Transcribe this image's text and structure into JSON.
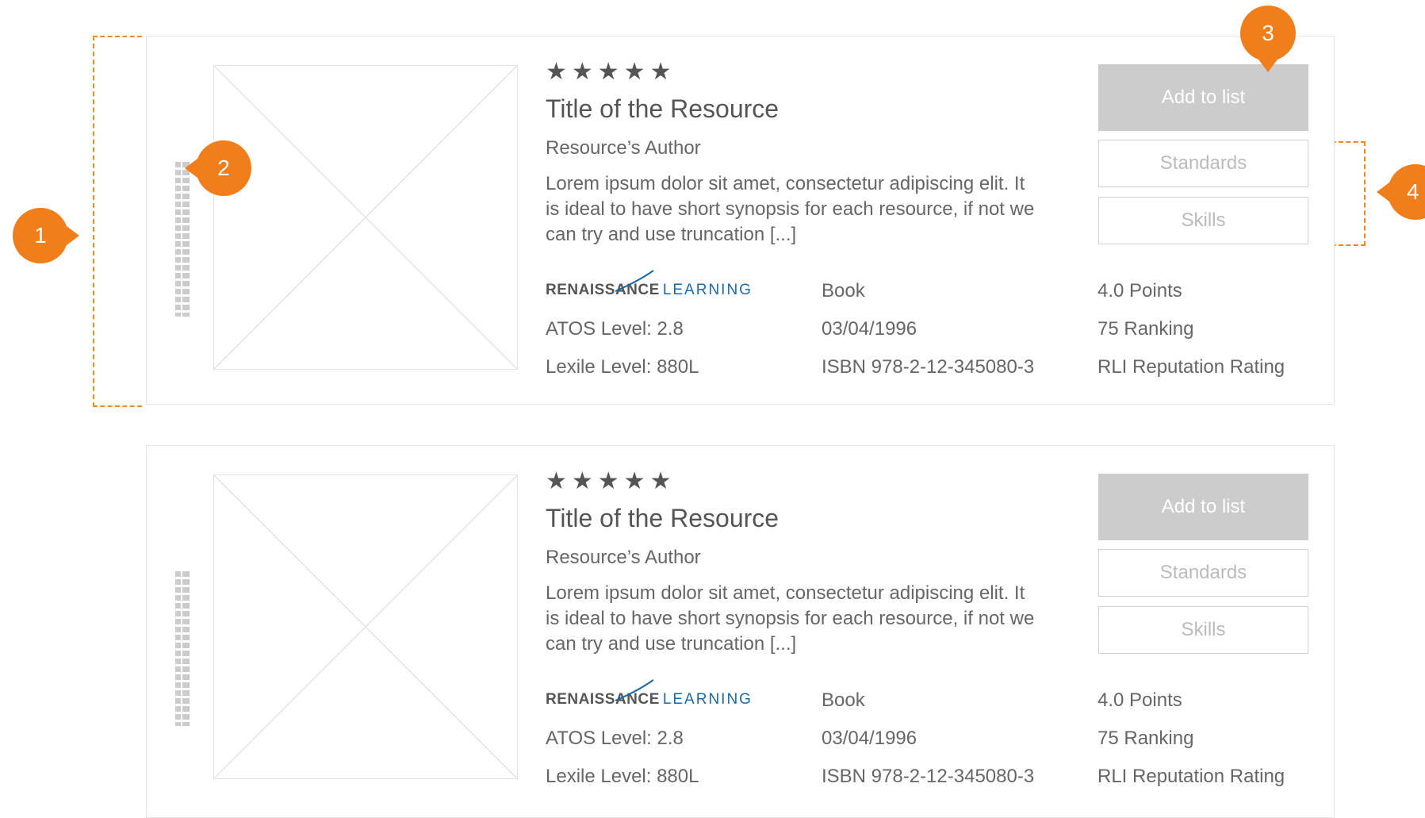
{
  "annotations": [
    "1",
    "2",
    "3",
    "4"
  ],
  "cards": [
    {
      "stars": "★★★★★",
      "title": "Title of the Resource",
      "author": "Resource’s Author",
      "synopsis": "Lorem ipsum dolor sit amet, consectetur adipiscing elit. It is ideal to have short synopsis for each resource, if not we can try and use truncation [...]",
      "logo_bold": "RENAISSANCE",
      "logo_light": "LEARNING",
      "atos": "ATOS Level: 2.8",
      "lexile": "Lexile Level: 880L",
      "type": "Book",
      "date": "03/04/1996",
      "isbn": "ISBN 978-2-12-345080-3",
      "points": "4.0 Points",
      "ranking": "75 Ranking",
      "rating": "RLI Reputation Rating",
      "add_label": "Add to list",
      "standards_label": "Standards",
      "skills_label": "Skills"
    },
    {
      "stars": "★★★★★",
      "title": "Title of the Resource",
      "author": "Resource’s Author",
      "synopsis": "Lorem ipsum dolor sit amet, consectetur adipiscing elit. It is ideal to have short synopsis for each resource, if not we can try and use truncation [...]",
      "logo_bold": "RENAISSANCE",
      "logo_light": "LEARNING",
      "atos": "ATOS Level: 2.8",
      "lexile": "Lexile Level: 880L",
      "type": "Book",
      "date": "03/04/1996",
      "isbn": "ISBN 978-2-12-345080-3",
      "points": "4.0 Points",
      "ranking": "75 Ranking",
      "rating": "RLI Reputation Rating",
      "add_label": "Add to list",
      "standards_label": "Standards",
      "skills_label": "Skills"
    }
  ],
  "colors": {
    "accent": "#f07e1a",
    "button_fill": "#cccccc",
    "logo_blue": "#1a6aa6"
  },
  "icons": {
    "drag": "drag-handle-icon",
    "image": "image-placeholder-icon",
    "rating": "star-icon"
  }
}
